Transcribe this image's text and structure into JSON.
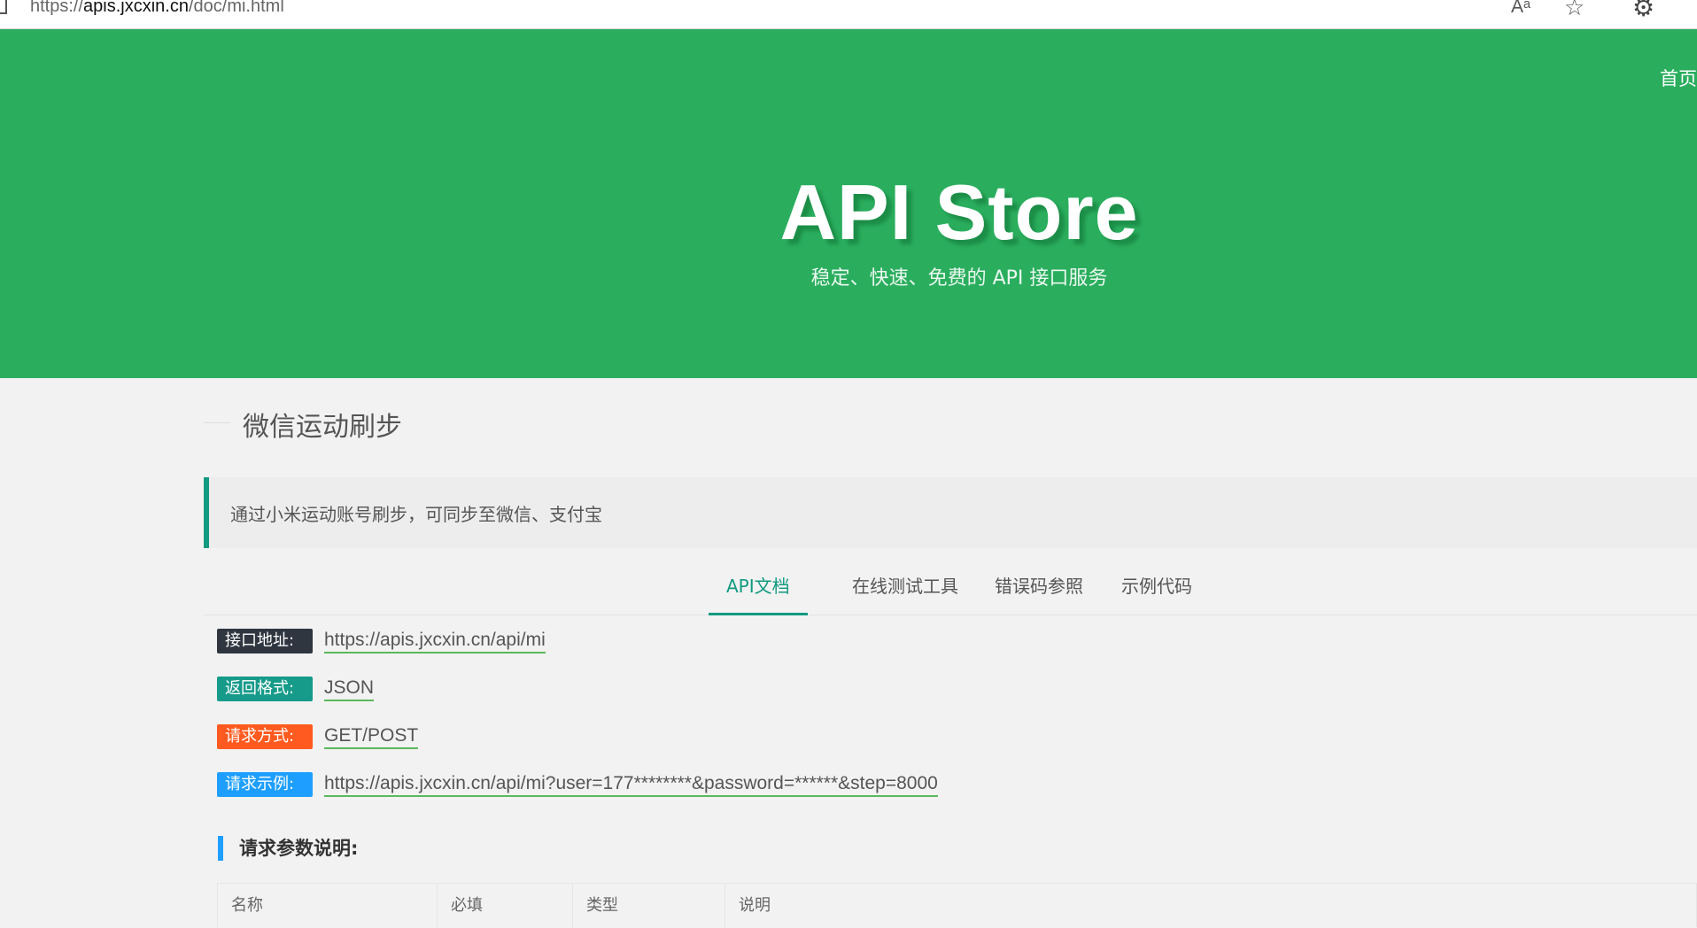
{
  "browser": {
    "url_prefix": "https://",
    "url_domain": "apis.jxcxin.cn",
    "url_path": "/doc/mi.html",
    "read_aloud_icon": "Aᵃ",
    "favorite_icon": "☆",
    "settings_icon": "⚙"
  },
  "hero": {
    "nav_home": "首页",
    "title": "API Store",
    "subtitle": "稳定、快速、免费的 API 接口服务",
    "background_color": "#2aae5e"
  },
  "section": {
    "title": "微信运动刷步",
    "intro": "通过小米运动账号刷步，可同步至微信、支付宝"
  },
  "tabs": [
    {
      "label": "API文档",
      "active": true
    },
    {
      "label": "在线测试工具",
      "active": false
    },
    {
      "label": "错误码参照",
      "active": false
    },
    {
      "label": "示例代码",
      "active": false
    }
  ],
  "info": {
    "url": {
      "label": "接口地址:",
      "value": "https://apis.jxcxin.cn/api/mi",
      "color": "#2f3640"
    },
    "format": {
      "label": "返回格式:",
      "value": "JSON",
      "color": "#169a89"
    },
    "method": {
      "label": "请求方式:",
      "value": "GET/POST",
      "color": "#ff5a1f"
    },
    "example": {
      "label": "请求示例:",
      "value": "https://apis.jxcxin.cn/api/mi?user=177********&password=******&step=8000",
      "color": "#1e9fff"
    }
  },
  "params": {
    "heading": "请求参数说明:",
    "columns": [
      "名称",
      "必填",
      "类型",
      "说明"
    ]
  }
}
